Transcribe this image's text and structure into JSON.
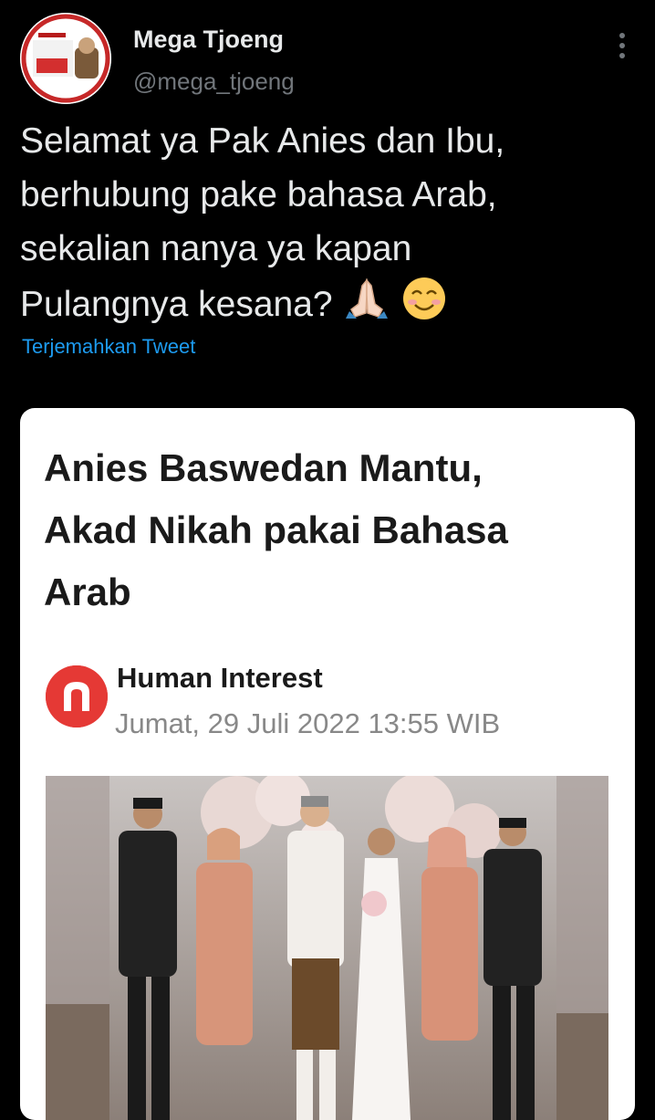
{
  "tweet": {
    "author_name": "Mega Tjoeng",
    "author_handle": "@mega_tjoeng",
    "text_lines": [
      "Selamat ya Pak Anies dan Ibu,",
      "berhubung pake bahasa Arab,",
      "sekalian nanya ya kapan",
      "Pulangnya kesana?"
    ],
    "emojis": [
      "folded-hands-icon",
      "smiling-face-icon"
    ],
    "translate_label": "Terjemahkan Tweet"
  },
  "card": {
    "headline_lines": [
      "Anies Baswedan Mantu,",
      "Akad Nikah pakai Bahasa",
      "Arab"
    ],
    "source_name": "Human Interest",
    "date": "Jumat, 29 Juli 2022 13:55 WIB"
  },
  "colors": {
    "background": "#000000",
    "text": "#e7e9ea",
    "muted": "#71767b",
    "link": "#1d9bf0",
    "brand_red": "#e53935"
  }
}
